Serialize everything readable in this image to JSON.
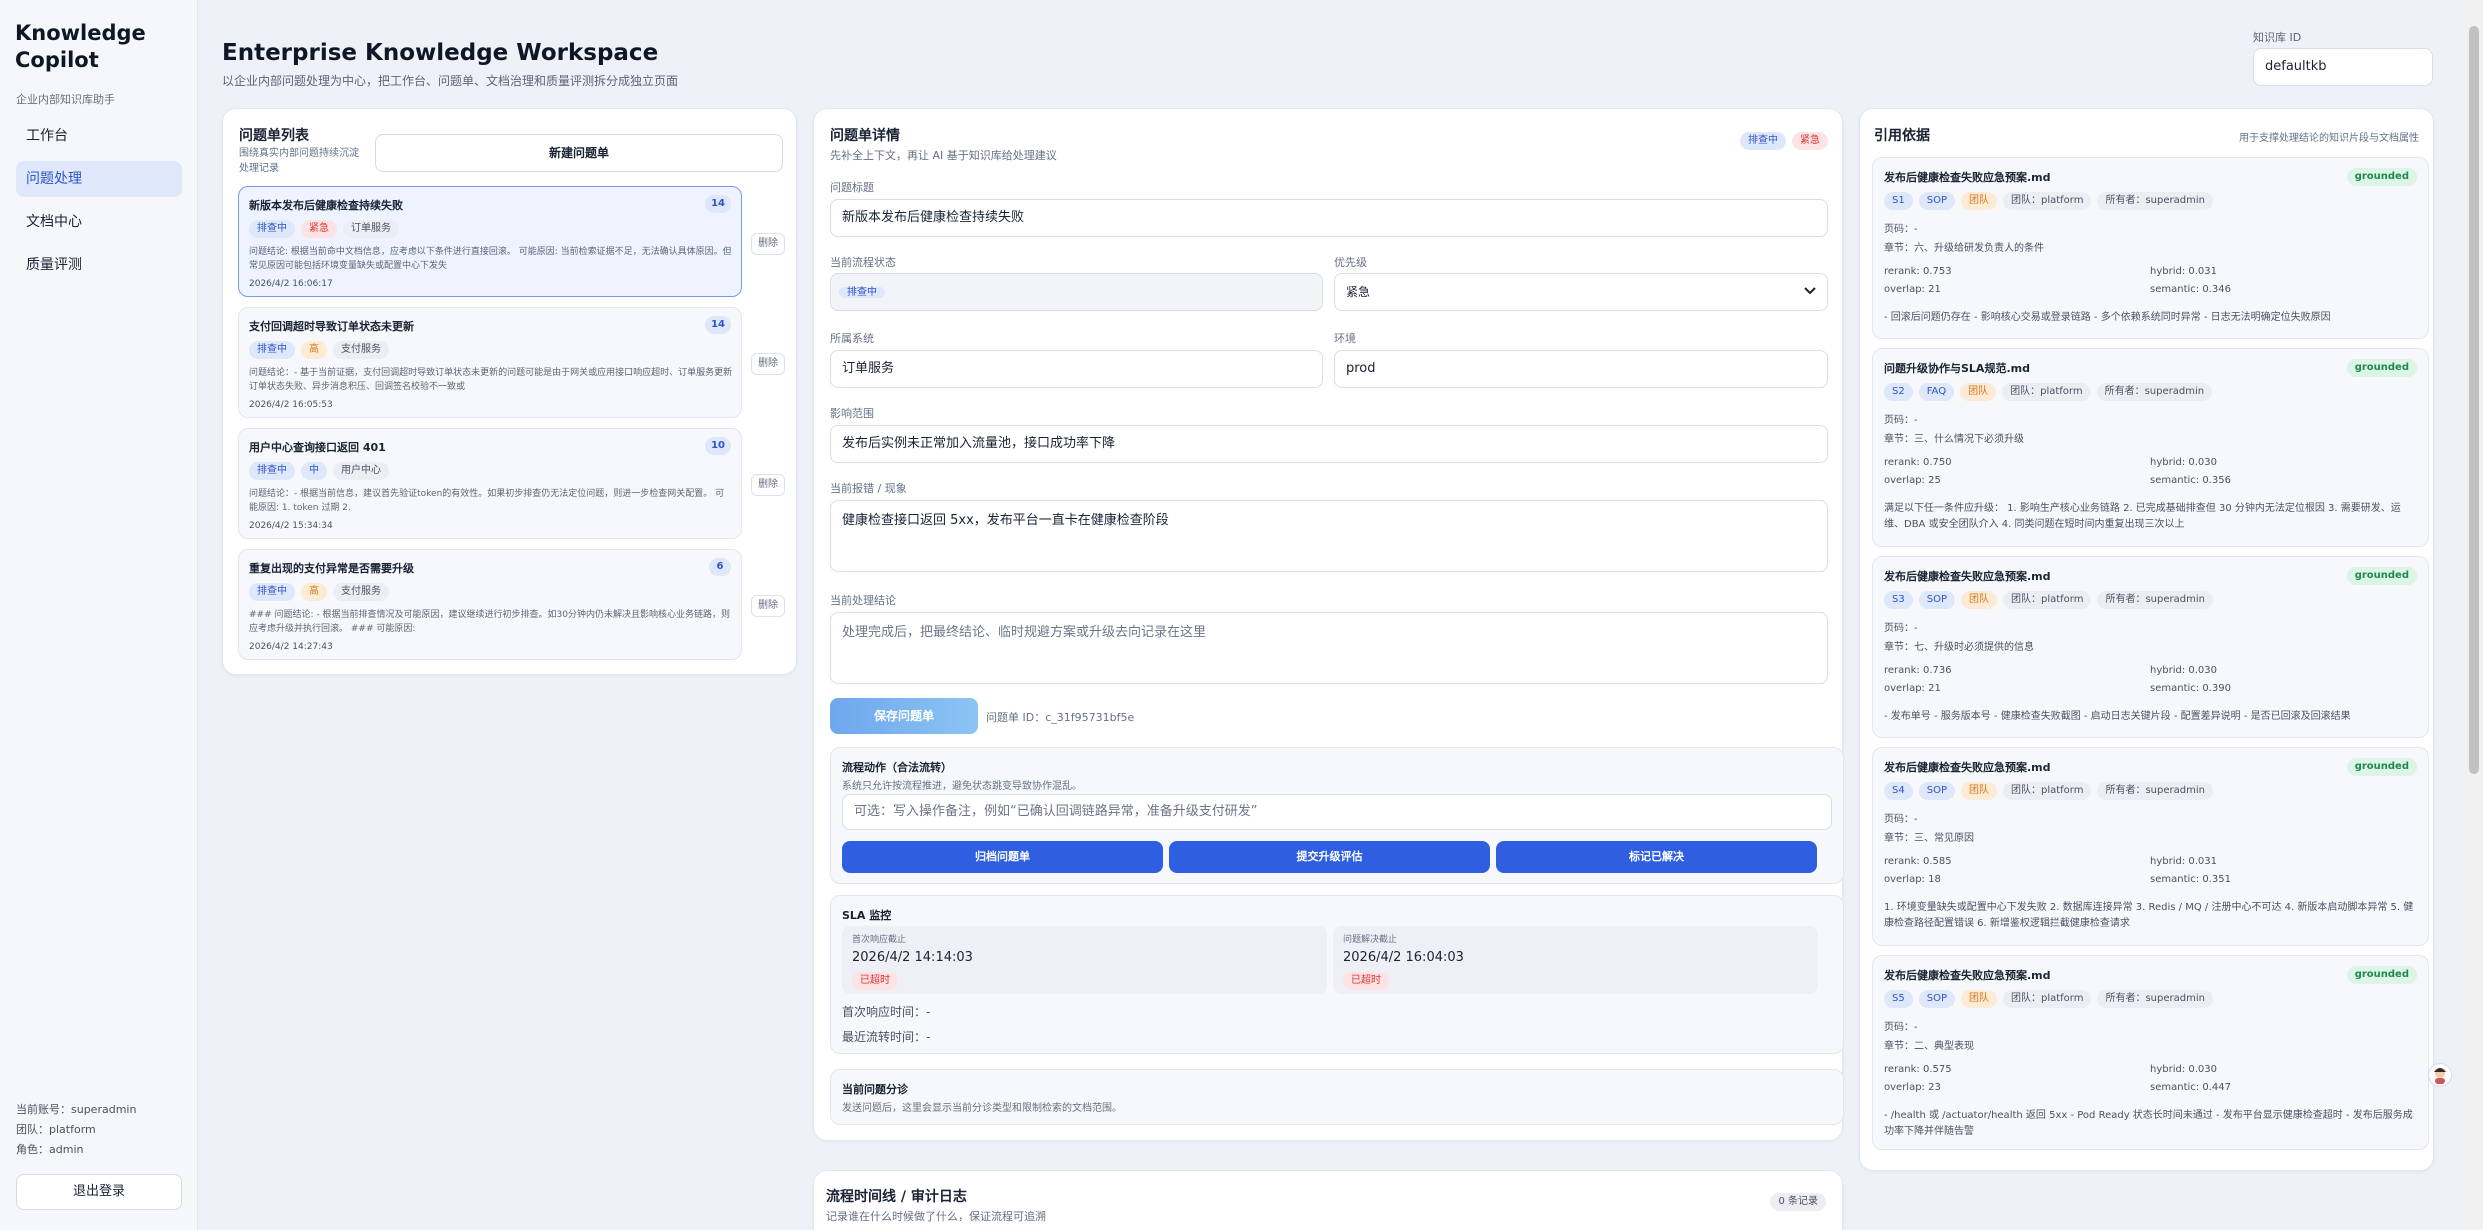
{
  "sidebar": {
    "brand": "Knowledge Copilot",
    "subtitle": "企业内部知识库助手",
    "nav": [
      "工作台",
      "问题处理",
      "文档中心",
      "质量评测"
    ],
    "account": "当前账号：superadmin",
    "team": "团队：platform",
    "role": "角色：admin",
    "logout": "退出登录"
  },
  "header": {
    "title": "Enterprise Knowledge Workspace",
    "subtitle": "以企业内部问题处理为中心，把工作台、问题单、文档治理和质量评测拆分成独立页面",
    "kb_label": "知识库 ID",
    "kb_value": "defaultkb"
  },
  "ticket_list": {
    "title": "问题单列表",
    "description": "围绕真实内部问题持续沉淀处理记录",
    "new_button": "新建问题单",
    "delete_label": "删除",
    "tickets": [
      {
        "title": "新版本发布后健康检查持续失败",
        "count": "14",
        "tags": [
          "排查中",
          "紧急",
          "订单服务"
        ],
        "body": "问题结论: 根据当前命中文档信息，应考虑以下条件进行直接回滚。 可能原因: 当前检索证据不足，无法确认具体原因。但常见原因可能包括环境变量缺失或配置中心下发失",
        "time": "2026/4/2 16:06:17"
      },
      {
        "title": "支付回调超时导致订单状态未更新",
        "count": "14",
        "tags": [
          "排查中",
          "高",
          "支付服务"
        ],
        "body": "问题结论：- 基于当前证据，支付回调超时导致订单状态未更新的问题可能是由于网关或应用接口响应超时、订单服务更新订单状态失败、异步消息积压、回调签名校验不一致或",
        "time": "2026/4/2 16:05:53"
      },
      {
        "title": "用户中心查询接口返回 401",
        "count": "10",
        "tags": [
          "排查中",
          "中",
          "用户中心"
        ],
        "body": "问题结论：- 根据当前信息，建议首先验证token的有效性。如果初步排查仍无法定位问题，则进一步检查网关配置。 可能原因: 1. token 过期 2.",
        "time": "2026/4/2 15:34:34"
      },
      {
        "title": "重复出现的支付异常是否需要升级",
        "count": "6",
        "tags": [
          "排查中",
          "高",
          "支付服务"
        ],
        "body": "### 问题结论: - 根据当前排查情况及可能原因，建议继续进行初步排查。如30分钟内仍未解决且影响核心业务链路，则应考虑升级并执行回滚。 ### 可能原因:",
        "time": "2026/4/2 14:27:43"
      }
    ]
  },
  "detail": {
    "title": "问题单详情",
    "subtitle": "先补全上下文，再让 AI 基于知识库给处理建议",
    "badges": [
      "排查中",
      "紧急"
    ],
    "title_label": "问题标题",
    "title_value": "新版本发布后健康检查持续失败",
    "status_label": "当前流程状态",
    "status_value": "排查中",
    "priority_label": "优先级",
    "priority_value": "紧急",
    "system_label": "所属系统",
    "system_value": "订单服务",
    "env_label": "环境",
    "env_value": "prod",
    "impact_label": "影响范围",
    "impact_value": "发布后实例未正常加入流量池，接口成功率下降",
    "symptom_label": "当前报错 / 现象",
    "symptom_value": "健康检查接口返回 5xx，发布平台一直卡在健康检查阶段",
    "conclusion_label": "当前处理结论",
    "conclusion_placeholder": "处理完成后，把最终结论、临时规避方案或升级去向记录在这里",
    "save_button": "保存问题单",
    "ticket_id": "问题单 ID：c_31f95731bf5e",
    "workflow": {
      "title": "流程动作（合法流转）",
      "desc": "系统只允许按流程推进，避免状态跳变导致协作混乱。",
      "note_placeholder": "可选：写入操作备注，例如“已确认回调链路异常，准备升级支付研发”",
      "buttons": [
        "归档问题单",
        "提交升级评估",
        "标记已解决"
      ]
    },
    "sla": {
      "title": "SLA 监控",
      "first_label": "首次响应截止",
      "first_value": "2026/4/2 14:14:03",
      "resolve_label": "问题解决截止",
      "resolve_value": "2026/4/2 16:04:03",
      "overdue": "已超时",
      "first_response": "首次响应时间：-",
      "last_transition": "最近流转时间：-"
    },
    "triage": {
      "title": "当前问题分诊",
      "desc": "发送问题后，这里会显示当前分诊类型和限制检索的文档范围。"
    }
  },
  "timeline": {
    "title": "流程时间线 / 审计日志",
    "desc": "记录谁在什么时候做了什么，保证流程可追溯",
    "count": "0 条记录"
  },
  "citations": {
    "title": "引用依据",
    "desc": "用于支撑处理结论的知识片段与文档属性",
    "items": [
      {
        "file": "发布后健康检查失败应急预案.md",
        "status": "grounded",
        "tags": [
          "S1",
          "SOP",
          "团队",
          "团队：platform",
          "所有者：superadmin"
        ],
        "page": "页码：-",
        "section": "章节：六、升级给研发负责人的条件",
        "rerank": "rerank: 0.753",
        "hybrid": "hybrid: 0.031",
        "overlap": "overlap: 21",
        "semantic": "semantic: 0.346",
        "text": "- 回滚后问题仍存在 - 影响核心交易或登录链路 - 多个依赖系统同时异常 - 日志无法明确定位失败原因"
      },
      {
        "file": "问题升级协作与SLA规范.md",
        "status": "grounded",
        "tags": [
          "S2",
          "FAQ",
          "团队",
          "团队：platform",
          "所有者：superadmin"
        ],
        "page": "页码：-",
        "section": "章节：三、什么情况下必须升级",
        "rerank": "rerank: 0.750",
        "hybrid": "hybrid: 0.030",
        "overlap": "overlap: 25",
        "semantic": "semantic: 0.356",
        "text": "满足以下任一条件应升级： 1. 影响生产核心业务链路 2. 已完成基础排查但 30 分钟内无法定位根因 3. 需要研发、运维、DBA 或安全团队介入 4. 同类问题在短时间内重复出现三次以上"
      },
      {
        "file": "发布后健康检查失败应急预案.md",
        "status": "grounded",
        "tags": [
          "S3",
          "SOP",
          "团队",
          "团队：platform",
          "所有者：superadmin"
        ],
        "page": "页码：-",
        "section": "章节：七、升级时必须提供的信息",
        "rerank": "rerank: 0.736",
        "hybrid": "hybrid: 0.030",
        "overlap": "overlap: 21",
        "semantic": "semantic: 0.390",
        "text": "- 发布单号 - 服务版本号 - 健康检查失败截图 - 启动日志关键片段 - 配置差异说明 - 是否已回滚及回滚结果"
      },
      {
        "file": "发布后健康检查失败应急预案.md",
        "status": "grounded",
        "tags": [
          "S4",
          "SOP",
          "团队",
          "团队：platform",
          "所有者：superadmin"
        ],
        "page": "页码：-",
        "section": "章节：三、常见原因",
        "rerank": "rerank: 0.585",
        "hybrid": "hybrid: 0.031",
        "overlap": "overlap: 18",
        "semantic": "semantic: 0.351",
        "text": "1. 环境变量缺失或配置中心下发失败 2. 数据库连接异常 3. Redis / MQ / 注册中心不可达 4. 新版本启动脚本异常 5. 健康检查路径配置错误 6. 新增鉴权逻辑拦截健康检查请求"
      },
      {
        "file": "发布后健康检查失败应急预案.md",
        "status": "grounded",
        "tags": [
          "S5",
          "SOP",
          "团队",
          "团队：platform",
          "所有者：superadmin"
        ],
        "page": "页码：-",
        "section": "章节：二、典型表现",
        "rerank": "rerank: 0.575",
        "hybrid": "hybrid: 0.030",
        "overlap": "overlap: 23",
        "semantic": "semantic: 0.447",
        "text": "- /health 或 /actuator/health 返回 5xx - Pod Ready 状态长时间未通过 - 发布平台显示健康检查超时 - 发布后服务成功率下降并伴随告警"
      }
    ]
  }
}
